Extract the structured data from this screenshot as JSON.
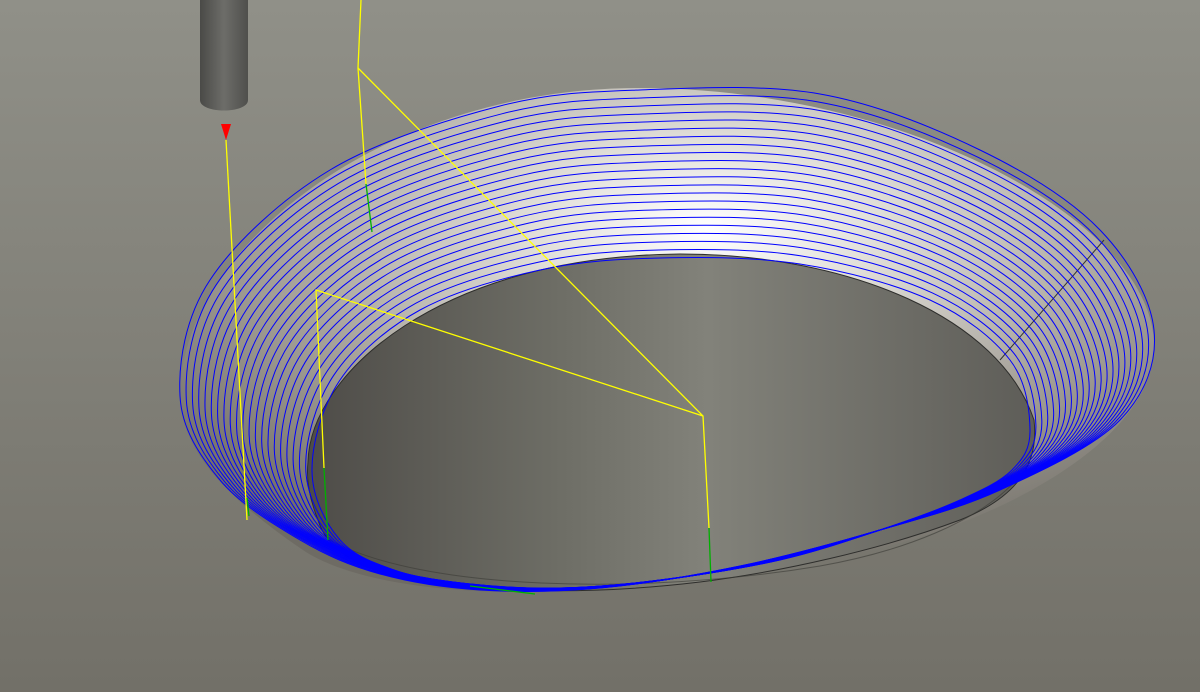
{
  "viewport": {
    "background_gradient": [
      "#909088",
      "#727068"
    ],
    "surface_shading": [
      "#ffffff",
      "#e0ded8",
      "#a8a49c",
      "#6e6b64"
    ],
    "hole_shading": [
      "#4e4c48",
      "#6e6e66",
      "#82827a",
      "#5e5d58"
    ]
  },
  "toolpath": {
    "finishing_pass_color": "#0000ff",
    "rapid_move_color": "#ffff00",
    "plunge_move_color": "#00b000",
    "finishing_pass_count": 22
  },
  "tool": {
    "shank_color": "#5f5f5b",
    "tip_marker_color": "#ff0000"
  }
}
